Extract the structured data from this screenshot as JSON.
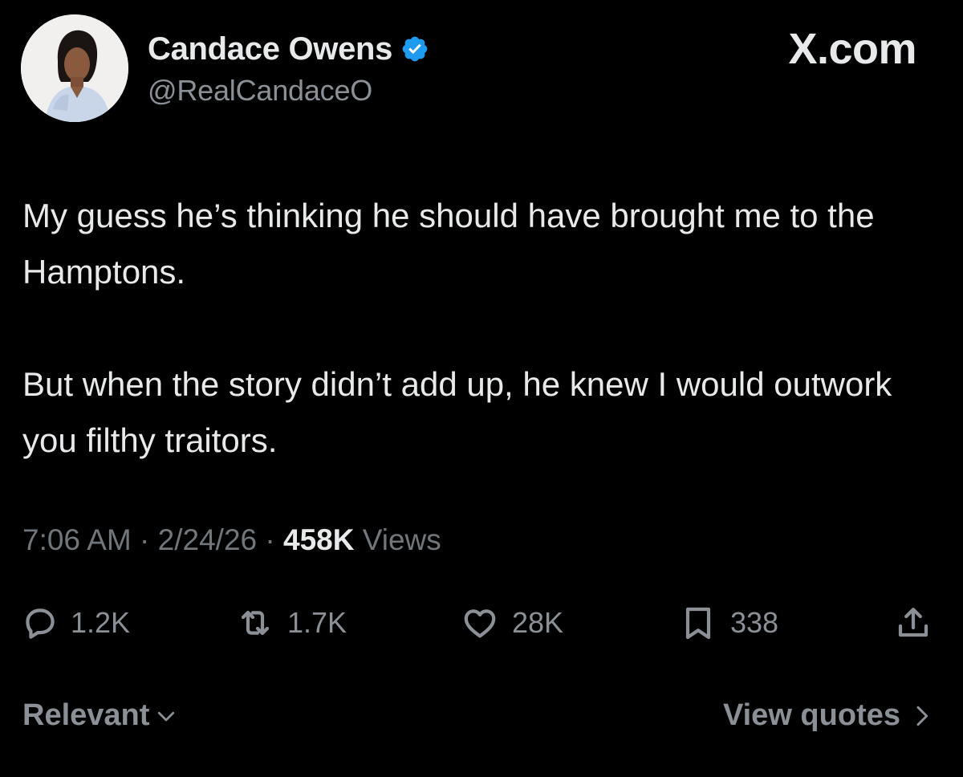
{
  "author": {
    "display_name": "Candace Owens",
    "handle": "@RealCandaceO",
    "verified": true,
    "verified_icon": "verified-badge-icon",
    "avatar": "avatar"
  },
  "watermark": "X.com",
  "tweet": {
    "paragraphs": [
      "My guess he’s thinking he should have brought me to the Hamptons.",
      "But when the story didn’t add up,  he knew I would outwork you filthy traitors."
    ]
  },
  "meta": {
    "time": "7:06 AM",
    "separator": " · ",
    "date": "2/24/26",
    "views_count": "458K",
    "views_label": " Views"
  },
  "actions": {
    "replies": {
      "icon": "reply-icon",
      "count": "1.2K"
    },
    "reposts": {
      "icon": "repost-icon",
      "count": "1.7K"
    },
    "likes": {
      "icon": "heart-icon",
      "count": "28K"
    },
    "bookmarks": {
      "icon": "bookmark-icon",
      "count": "338"
    },
    "share": {
      "icon": "share-icon"
    }
  },
  "footer": {
    "sort_label": "Relevant",
    "sort_icon": "chevron-down-icon",
    "quotes_label": "View quotes",
    "quotes_icon": "chevron-right-icon"
  },
  "colors": {
    "background": "#000000",
    "primary_text": "#e7e9ea",
    "secondary_text": "#71767b",
    "verified_blue": "#1d9bf0"
  }
}
